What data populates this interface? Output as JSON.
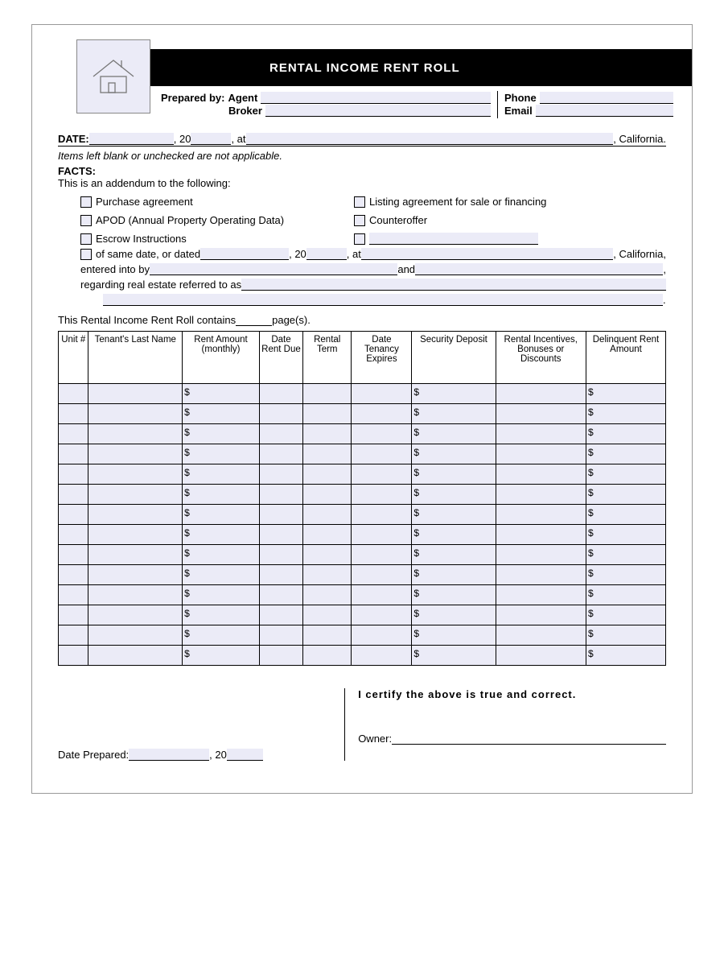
{
  "header": {
    "title": "RENTAL INCOME RENT ROLL"
  },
  "prepared": {
    "prepared_by": "Prepared by:",
    "agent": "Agent",
    "broker": "Broker",
    "phone": "Phone",
    "email": "Email"
  },
  "dateline": {
    "date": "DATE:",
    "twenty": ", 20",
    "at": ", at",
    "california": ", California."
  },
  "note": "Items left blank or unchecked are not applicable.",
  "facts": {
    "heading": "FACTS:",
    "intro": "This is an addendum to the following:",
    "opt1": "Purchase agreement",
    "opt2": "APOD (Annual Property Operating Data)",
    "opt3": "Escrow Instructions",
    "opt4a": "of same date, or dated",
    "opt4_twenty": ", 20",
    "opt4_at": ", at",
    "opt4_california": ", California,",
    "opt5": "Listing agreement for sale or financing",
    "opt6": "Counteroffer",
    "entered": "entered into by",
    "and": " and ",
    "regarding": "regarding real estate referred to as"
  },
  "pages_line": {
    "prefix": "This Rental Income Rent Roll contains ",
    "suffix": " page(s)."
  },
  "table": {
    "headers": [
      "Unit #",
      "Tenant's Last Name",
      "Rent Amount (monthly)",
      "Date Rent Due",
      "Rental Term",
      "Date Tenancy Expires",
      "Security Deposit",
      "Rental Incentives, Bonuses or Discounts",
      "Delinquent Rent Amount"
    ],
    "row_count": 14
  },
  "footer": {
    "date_prepared": "Date Prepared:",
    "twenty": ", 20",
    "certify": "I certify the above is true and correct.",
    "owner": "Owner:"
  }
}
